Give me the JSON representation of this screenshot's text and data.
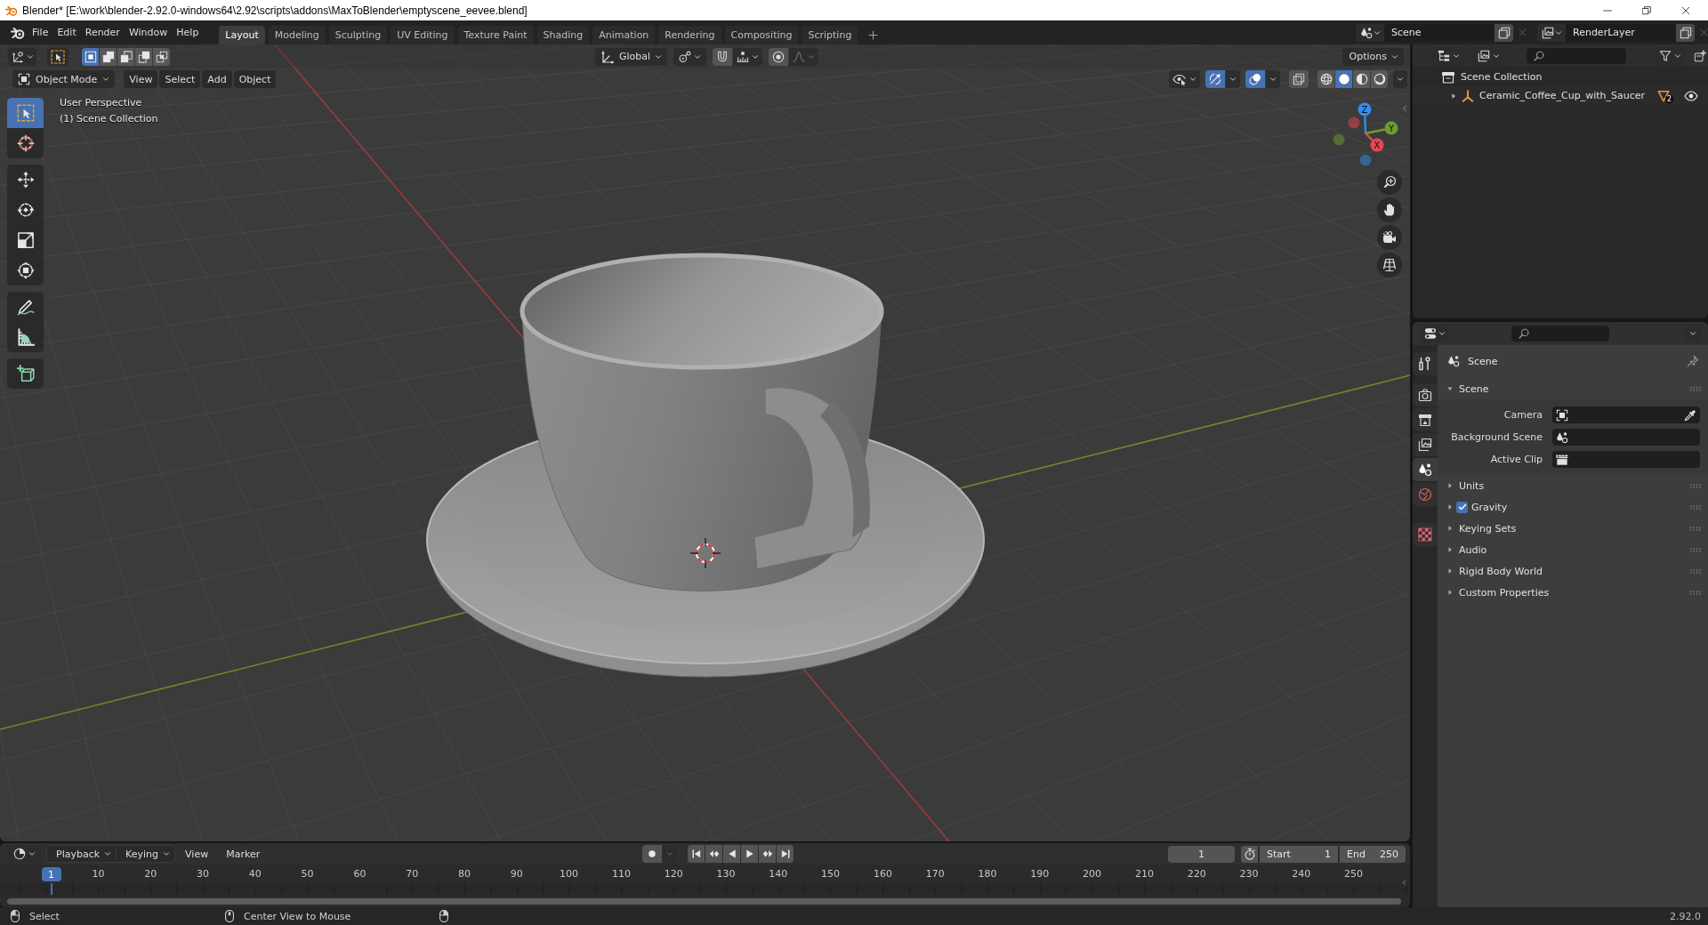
{
  "window": {
    "title": "Blender* [E:\\work\\blender-2.92.0-windows64\\2.92\\scripts\\addons\\MaxToBlender\\emptyscene_eevee.blend]"
  },
  "menu_bar": [
    "File",
    "Edit",
    "Render",
    "Window",
    "Help"
  ],
  "workspace_tabs": [
    {
      "label": "Layout",
      "selected": true
    },
    {
      "label": "Modeling",
      "selected": false
    },
    {
      "label": "Sculpting",
      "selected": false
    },
    {
      "label": "UV Editing",
      "selected": false
    },
    {
      "label": "Texture Paint",
      "selected": false
    },
    {
      "label": "Shading",
      "selected": false
    },
    {
      "label": "Animation",
      "selected": false
    },
    {
      "label": "Rendering",
      "selected": false
    },
    {
      "label": "Compositing",
      "selected": false
    },
    {
      "label": "Scripting",
      "selected": false
    }
  ],
  "scene": {
    "value": "Scene"
  },
  "view_layer": {
    "value": "RenderLayer"
  },
  "tool_settings": {
    "select_modes": [
      {
        "kind": "set",
        "selected": true
      },
      {
        "kind": "extend",
        "selected": false
      },
      {
        "kind": "subtract",
        "selected": false
      },
      {
        "kind": "difference",
        "selected": false
      },
      {
        "kind": "intersect",
        "selected": false
      }
    ],
    "orientation": "Global",
    "snap": false,
    "proportional_editing": false,
    "options": "Options"
  },
  "viewport_header": {
    "mode": "Object Mode",
    "menus": [
      "View",
      "Select",
      "Add",
      "Object"
    ],
    "gizmos": true,
    "overlays": true,
    "xray": false,
    "shading": [
      {
        "kind": "wireframe",
        "selected": false
      },
      {
        "kind": "solid",
        "selected": true
      },
      {
        "kind": "material",
        "selected": false
      },
      {
        "kind": "rendered",
        "selected": false
      }
    ]
  },
  "toolbar": [
    {
      "tools": [
        {
          "kind": "select_box",
          "selected": true
        },
        {
          "kind": "cursor",
          "selected": false
        }
      ]
    },
    {
      "tools": [
        {
          "kind": "move",
          "selected": false
        },
        {
          "kind": "rotate",
          "selected": false
        },
        {
          "kind": "scale",
          "selected": false
        },
        {
          "kind": "transform",
          "selected": false
        }
      ]
    },
    {
      "tools": [
        {
          "kind": "annotate",
          "selected": false
        },
        {
          "kind": "measure",
          "selected": false
        }
      ]
    },
    {
      "tools": [
        {
          "kind": "add_cube",
          "selected": false
        }
      ]
    }
  ],
  "viewport": {
    "view_name": "User Perspective",
    "collection": "(1) Scene Collection",
    "gizmo_axes": [
      {
        "label": "Z",
        "color": "#2f8ef0"
      },
      {
        "label": "Y",
        "color": "#6f9c30"
      },
      {
        "label": "X",
        "color": "#ec4556"
      }
    ]
  },
  "outliner": {
    "tree": [
      {
        "label": "Scene Collection",
        "children": [
          {
            "label": "Ceramic_Coffee_Cup_with_Saucer",
            "expanded": false,
            "data_users": "2",
            "visible": true
          }
        ]
      }
    ]
  },
  "properties": {
    "tab_groups": [
      {
        "tabs": [
          {
            "kind": "tool",
            "selected": false
          }
        ]
      },
      {
        "tabs": [
          {
            "kind": "render",
            "selected": false
          },
          {
            "kind": "output",
            "selected": false
          },
          {
            "kind": "view_layer",
            "selected": false
          },
          {
            "kind": "scene",
            "selected": true
          },
          {
            "kind": "world",
            "selected": false
          }
        ]
      },
      {
        "tabs": [
          {
            "kind": "texture",
            "selected": false
          }
        ]
      }
    ],
    "context": "Scene",
    "panels": [
      {
        "label": "Scene",
        "expanded": true,
        "fields": [
          {
            "label": "Camera",
            "kind": "camera"
          },
          {
            "label": "Background Scene",
            "kind": "scene"
          },
          {
            "label": "Active Clip",
            "kind": "clip"
          }
        ]
      },
      {
        "label": "Units",
        "expanded": false
      },
      {
        "label": "Gravity",
        "expanded": false,
        "toggle": {
          "checked": true
        }
      },
      {
        "label": "Keying Sets",
        "expanded": false
      },
      {
        "label": "Audio",
        "expanded": false
      },
      {
        "label": "Rigid Body World",
        "expanded": false
      },
      {
        "label": "Custom Properties",
        "expanded": false
      }
    ]
  },
  "timeline": {
    "menus": [
      {
        "label": "Playback",
        "kind": "dropdown"
      },
      {
        "label": "Keying",
        "kind": "dropdown"
      },
      {
        "label": "View",
        "kind": "menu"
      },
      {
        "label": "Marker",
        "kind": "menu"
      }
    ],
    "auto_keying": false,
    "current_frame": "1",
    "start_label": "Start",
    "start": "1",
    "end_label": "End",
    "end": "250",
    "playhead": "1",
    "ticks": [
      "10",
      "20",
      "30",
      "40",
      "50",
      "60",
      "70",
      "80",
      "90",
      "100",
      "110",
      "120",
      "130",
      "140",
      "150",
      "160",
      "170",
      "180",
      "190",
      "200",
      "210",
      "220",
      "230",
      "240",
      "250"
    ]
  },
  "status_bar": {
    "hints": [
      {
        "kind": "left_click",
        "label": "Select"
      },
      {
        "kind": "middle_click",
        "label": "Center View to Mouse"
      },
      {
        "kind": "right_click"
      }
    ],
    "version": "2.92.0"
  }
}
